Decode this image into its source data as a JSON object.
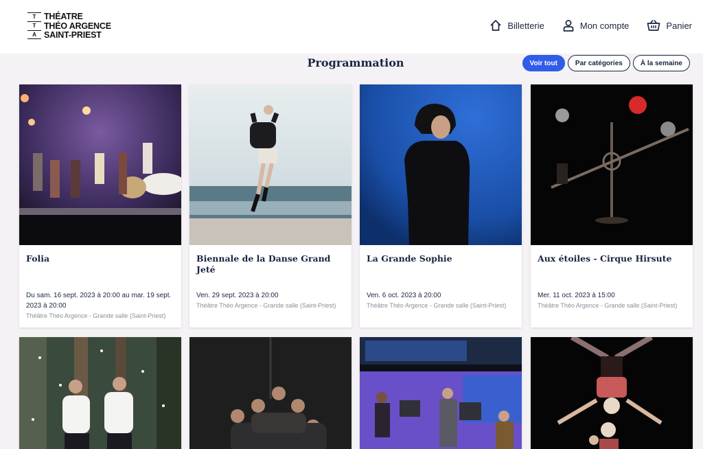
{
  "logo": {
    "marks": [
      "T",
      "T",
      "A"
    ],
    "lines": [
      "THÉATRE",
      "THÉO ARGENCE",
      "SAINT-PRIEST"
    ]
  },
  "nav": {
    "billetterie": "Billetterie",
    "compte": "Mon compte",
    "panier": "Panier"
  },
  "section": {
    "title": "Programmation"
  },
  "filters": [
    {
      "label": "Voir tout",
      "active": true
    },
    {
      "label": "Par catégories",
      "active": false
    },
    {
      "label": "À la semaine",
      "active": false
    }
  ],
  "events": [
    {
      "title": "Folia",
      "date": "Du sam. 16 sept. 2023 à 20:00 au mar. 19 sept. 2023 à 20:00",
      "venue": "Théâtre Théo Argence - Grande salle  (Saint-Priest)"
    },
    {
      "title": "Biennale de la Danse Grand Jeté",
      "date": "Ven. 29 sept. 2023 à 20:00",
      "venue": "Théâtre Théo Argence - Grande salle  (Saint-Priest)"
    },
    {
      "title": "La Grande Sophie",
      "date": "Ven. 6 oct. 2023 à 20:00",
      "venue": "Théâtre Théo Argence - Grande salle  (Saint-Priest)"
    },
    {
      "title": "Aux étoiles - Cirque Hirsute",
      "date": "Mer. 11 oct. 2023 à 15:00",
      "venue": "Théâtre Théo Argence - Grande salle  (Saint-Priest)"
    }
  ],
  "colors": {
    "accent": "#2f5ce8",
    "navy": "#1a2540",
    "background": "#f4f2f4"
  }
}
